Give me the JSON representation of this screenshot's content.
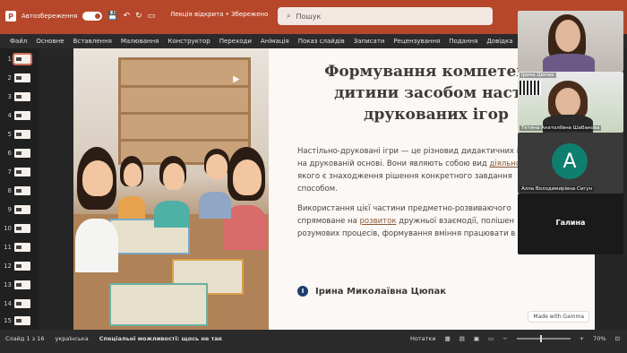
{
  "titlebar": {
    "autosave_label": "Автозбереження",
    "doc_title": "Лекція відкрита • Збережено",
    "search_placeholder": "Пошук"
  },
  "menu": [
    "Файл",
    "Основне",
    "Вставлення",
    "Малювання",
    "Конструктор",
    "Переходи",
    "Анімація",
    "Показ слайдів",
    "Записати",
    "Рецензування",
    "Подання",
    "Довідка",
    "Ac"
  ],
  "thumbnails": [
    "1",
    "2",
    "3",
    "4",
    "5",
    "6",
    "7",
    "8",
    "9",
    "10",
    "11",
    "12",
    "13",
    "14",
    "15"
  ],
  "slide": {
    "title_line1": "Формування компетентн",
    "title_line2": "дитини засобом настіл",
    "title_line3": "друкованих ігор",
    "p1_a": "Настільно-друковані ігри — це різновид дидактичних ігор",
    "p1_b": "на друкованій основі. Вони являють собою вид ",
    "p1_u": "діяльності",
    "p1_c": "якого є знаходження рішення конкретного завдання",
    "p1_d": "способом.",
    "p2_a": "Використання цієї частини предметно-розвиваючого",
    "p2_b": "спрямоване на ",
    "p2_u": "розвиток",
    "p2_c": " дружньої взаємодії, полішен",
    "p2_d": "розумових процесів, формування вміння працювати в кома",
    "author_initial": "I",
    "author": "Ірина Миколаївна  Цюпак",
    "badge": "Made with Gamma"
  },
  "participants": [
    {
      "name": ""
    },
    {
      "name": "Тетяна Анатоліївна Шабанова",
      "tag": "Ірина Цюпак"
    },
    {
      "name": "Алла Володимирівна Сигун",
      "initial": "А"
    },
    {
      "name": "Галина"
    }
  ],
  "status": {
    "slide_info": "Слайд 1 з 16",
    "language": "українська",
    "accessibility": "Спеціальні можливості: щось не так",
    "notes": "Нотатки",
    "zoom": "70%"
  }
}
